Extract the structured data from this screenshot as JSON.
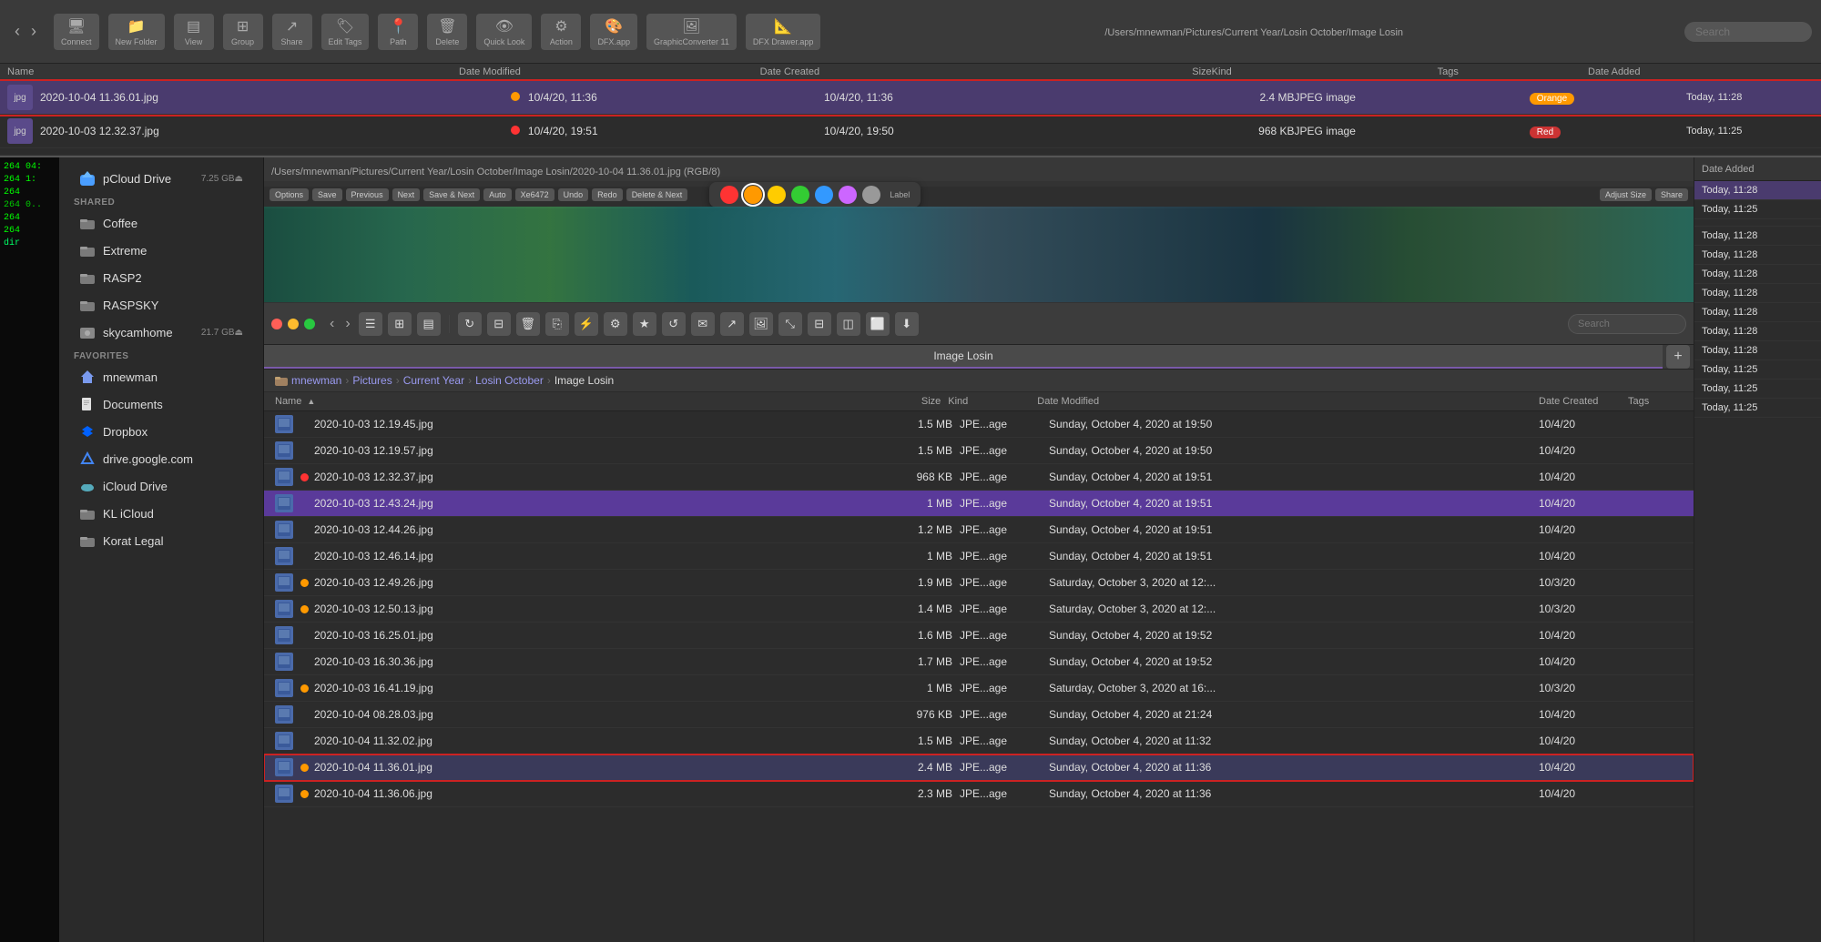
{
  "topbar": {
    "path": "/Users/mnewman/Pictures/Current Year/Losin October/Image Losin",
    "back_label": "‹",
    "forward_label": "›",
    "buttons": [
      "Connect",
      "New Folder",
      "View",
      "Group",
      "Share",
      "Edit Tags",
      "Path",
      "Delete",
      "Quick Look",
      "Action",
      "DFX.app",
      "GraphicConverter 11",
      "DFX Drawer.app"
    ],
    "search_placeholder": "Search"
  },
  "upper_finder": {
    "columns": [
      "Name",
      "Date Modified",
      "Date Created",
      "Size",
      "Kind",
      "Tags",
      "Date Added"
    ],
    "rows": [
      {
        "name": "2020-10-04 11.36.01.jpg",
        "modified": "10/4/20, 11:36",
        "created": "10/4/20, 11:36",
        "size": "2.4 MB",
        "kind": "JPEG image",
        "tag": "Orange",
        "date_added": "Today, 11:28",
        "selected": true,
        "dot": "orange"
      },
      {
        "name": "2020-10-03 12.32.37.jpg",
        "modified": "10/4/20, 19:51",
        "created": "10/4/20, 19:50",
        "size": "968 KB",
        "kind": "JPEG image",
        "tag": "Red",
        "date_added": "Today, 11:25",
        "selected": false,
        "dot": "red"
      }
    ],
    "more_rows_dates": [
      "Today, 11:28",
      "Today, 11:28",
      "Today, 11:28",
      "Today, 11:28",
      "Today, 11:28",
      "Today, 11:25",
      "Today, 11:25",
      "Today, 11:25"
    ]
  },
  "preview_toolbar": {
    "path_label": "/Users/mnewman/Pictures/Current Year/Losin October/Image Losin/2020-10-04 11.36.01.jpg (RGB/8)",
    "buttons": [
      "Options",
      "Save",
      "Previous",
      "Next",
      "Save & Next",
      "Auto",
      "Xe6472",
      "Undo",
      "Redo",
      "Delete & Next"
    ],
    "label_caption": "Label",
    "label_colors": [
      "#ff3333",
      "#ff9900",
      "#ffcc00",
      "#33cc33",
      "#3399ff",
      "#cc66ff",
      "#999999"
    ],
    "active_label_index": 1,
    "right_buttons": [
      "Adjust Size",
      "Share"
    ]
  },
  "lower_finder": {
    "title": "Image Losin",
    "window_title": "Image Losin",
    "breadcrumb": [
      "mnewman",
      "Pictures",
      "Current Year",
      "Losin October",
      "Image Losin"
    ],
    "columns": [
      "Name",
      "Size",
      "Kind",
      "Date Modified",
      "Date Created",
      "Tags"
    ],
    "files": [
      {
        "name": "2020-10-03 12.19.45.jpg",
        "size": "1.5 MB",
        "kind": "JPE...age",
        "modified": "Sunday, October 4, 2020 at 19:50",
        "created": "10/4/20",
        "dot": "none"
      },
      {
        "name": "2020-10-03 12.19.57.jpg",
        "size": "1.5 MB",
        "kind": "JPE...age",
        "modified": "Sunday, October 4, 2020 at 19:50",
        "created": "10/4/20",
        "dot": "none"
      },
      {
        "name": "2020-10-03 12.32.37.jpg",
        "size": "968 KB",
        "kind": "JPE...age",
        "modified": "Sunday, October 4, 2020 at 19:51",
        "created": "10/4/20",
        "dot": "red"
      },
      {
        "name": "2020-10-03 12.43.24.jpg",
        "size": "1 MB",
        "kind": "JPE...age",
        "modified": "Sunday, October 4, 2020 at 19:51",
        "created": "10/4/20",
        "dot": "none",
        "selected": true
      },
      {
        "name": "2020-10-03 12.44.26.jpg",
        "size": "1.2 MB",
        "kind": "JPE...age",
        "modified": "Sunday, October 4, 2020 at 19:51",
        "created": "10/4/20",
        "dot": "none"
      },
      {
        "name": "2020-10-03 12.46.14.jpg",
        "size": "1 MB",
        "kind": "JPE...age",
        "modified": "Sunday, October 4, 2020 at 19:51",
        "created": "10/4/20",
        "dot": "none"
      },
      {
        "name": "2020-10-03 12.49.26.jpg",
        "size": "1.9 MB",
        "kind": "JPE...age",
        "modified": "Saturday, October 3, 2020 at 12:...",
        "created": "10/3/20",
        "dot": "orange"
      },
      {
        "name": "2020-10-03 12.50.13.jpg",
        "size": "1.4 MB",
        "kind": "JPE...age",
        "modified": "Saturday, October 3, 2020 at 12:...",
        "created": "10/3/20",
        "dot": "orange"
      },
      {
        "name": "2020-10-03 16.25.01.jpg",
        "size": "1.6 MB",
        "kind": "JPE...age",
        "modified": "Sunday, October 4, 2020 at 19:52",
        "created": "10/4/20",
        "dot": "none"
      },
      {
        "name": "2020-10-03 16.30.36.jpg",
        "size": "1.7 MB",
        "kind": "JPE...age",
        "modified": "Sunday, October 4, 2020 at 19:52",
        "created": "10/4/20",
        "dot": "none"
      },
      {
        "name": "2020-10-03 16.41.19.jpg",
        "size": "1 MB",
        "kind": "JPE...age",
        "modified": "Saturday, October 3, 2020 at 16:...",
        "created": "10/3/20",
        "dot": "orange"
      },
      {
        "name": "2020-10-04 08.28.03.jpg",
        "size": "976 KB",
        "kind": "JPE...age",
        "modified": "Sunday, October 4, 2020 at 21:24",
        "created": "10/4/20",
        "dot": "none"
      },
      {
        "name": "2020-10-04 11.32.02.jpg",
        "size": "1.5 MB",
        "kind": "JPE...age",
        "modified": "Sunday, October 4, 2020 at 11:32",
        "created": "10/4/20",
        "dot": "none"
      },
      {
        "name": "2020-10-04 11.36.01.jpg",
        "size": "2.4 MB",
        "kind": "JPE...age",
        "modified": "Sunday, October 4, 2020 at 11:36",
        "created": "10/4/20",
        "dot": "orange",
        "highlighted": true
      },
      {
        "name": "2020-10-04 11.36.06.jpg",
        "size": "2.3 MB",
        "kind": "JPE...age",
        "modified": "Sunday, October 4, 2020 at 11:36",
        "created": "10/4/20",
        "dot": "orange"
      }
    ]
  },
  "sidebar": {
    "pcloud_label": "pCloud Drive",
    "pcloud_size": "7.25 GB",
    "shared_label": "Shared",
    "items_shared": [
      {
        "label": "Coffee",
        "icon": "folder"
      },
      {
        "label": "Extreme",
        "icon": "folder"
      },
      {
        "label": "RASP2",
        "icon": "folder"
      },
      {
        "label": "RASPSKY",
        "icon": "folder"
      },
      {
        "label": "skycamhome",
        "icon": "drive",
        "size": "21.7 GB"
      }
    ],
    "favorites_label": "Favorites",
    "items_favorites": [
      {
        "label": "mnewman",
        "icon": "home"
      },
      {
        "label": "Documents",
        "icon": "docs"
      },
      {
        "label": "Dropbox",
        "icon": "dropbox"
      },
      {
        "label": "drive.google.com",
        "icon": "gdrive"
      },
      {
        "label": "iCloud Drive",
        "icon": "icloud"
      },
      {
        "label": "KL iCloud",
        "icon": "folder"
      },
      {
        "label": "Korat Legal",
        "icon": "folder"
      }
    ]
  },
  "terminal": {
    "lines": [
      "264 04:",
      "264 1:",
      "264",
      "264 0..",
      "264",
      "264",
      "dir"
    ]
  }
}
